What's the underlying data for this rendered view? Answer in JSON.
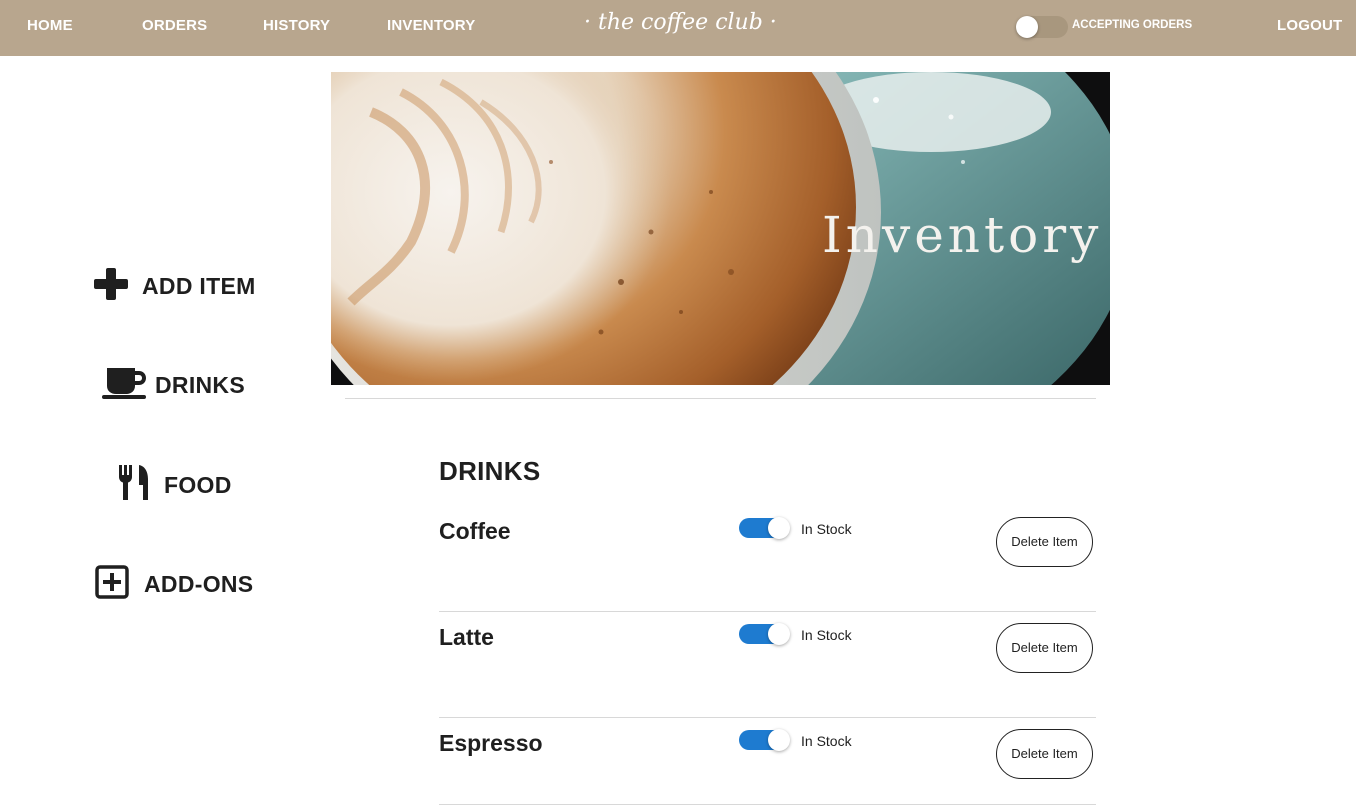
{
  "nav": {
    "home": "HOME",
    "orders": "ORDERS",
    "history": "HISTORY",
    "inventory": "INVENTORY",
    "brand": "· the coffee club ·",
    "accepting_orders": "ACCEPTING ORDERS",
    "accepting_orders_on": false,
    "logout": "LOGOUT"
  },
  "sidebar": {
    "items": [
      {
        "label": "ADD ITEM",
        "icon": "plus-icon"
      },
      {
        "label": "DRINKS",
        "icon": "coffee-cup-icon"
      },
      {
        "label": "FOOD",
        "icon": "utensils-icon"
      },
      {
        "label": "ADD-ONS",
        "icon": "plus-square-icon"
      }
    ]
  },
  "hero": {
    "title": "Inventory"
  },
  "section": {
    "title": "DRINKS"
  },
  "items": [
    {
      "name": "Coffee",
      "in_stock": true,
      "stock_label": "In Stock",
      "delete_label": "Delete Item"
    },
    {
      "name": "Latte",
      "in_stock": true,
      "stock_label": "In Stock",
      "delete_label": "Delete Item"
    },
    {
      "name": "Espresso",
      "in_stock": true,
      "stock_label": "In Stock",
      "delete_label": "Delete Item"
    }
  ],
  "colors": {
    "nav_bg": "#b8a68e",
    "toggle_on": "#1e7bd0"
  }
}
